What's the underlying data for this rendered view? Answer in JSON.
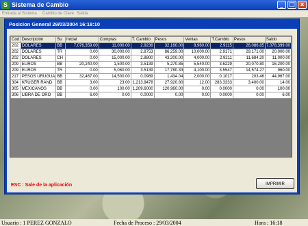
{
  "window": {
    "icon_letter": "S",
    "title": "Sistema de Cambio",
    "controls": {
      "minimize": "_",
      "maximize": "□",
      "close": "x"
    }
  },
  "menu": [
    "Entrada al Sistema",
    "Cambio de Clave",
    "Salida"
  ],
  "dialog": {
    "title": "Posicion General 29/03/2004 16:18:10",
    "table": {
      "headers": [
        "Cod",
        "Descripción",
        "Su",
        "Inicial",
        "Compras",
        "T. Cambio",
        "Pesos",
        "Ventas",
        "T.Cambio",
        "Pesos",
        "Saldo"
      ],
      "selected_row": 0,
      "rows": [
        [
          "202",
          "DOLARES",
          "BB",
          "7,076,359.00",
          "11,000.00",
          "2.9236",
          "32,160.00",
          "8,960.00",
          "2.9115",
          "26,086.85",
          "7,078,399.00"
        ],
        [
          "202",
          "DOLARES",
          "TR",
          "0.00",
          "30,000.00",
          "2.8753",
          "86,259.00",
          "10,000.00",
          "2.9171",
          "29,171.00",
          "20,000.00"
        ],
        [
          "202",
          "DOLARES",
          "CH",
          "0.00",
          "15,000.00",
          "2.8800",
          "43,200.00",
          "4,000.00",
          "2.9211",
          "11,684.20",
          "11,000.00"
        ],
        [
          "209",
          "EUROS",
          "BB",
          "20,240.00",
          "1,500.00",
          "3.5139",
          "5,270.85",
          "5,540.00",
          "3.6229",
          "20,070.80",
          "16,200.00"
        ],
        [
          "209",
          "EUROS",
          "TR",
          "0.00",
          "5,060.00",
          "3.5139",
          "17,780.33",
          "4,100.00",
          "3.5547",
          "14,574.27",
          "960.00"
        ],
        [
          "217",
          "PESOS URUGUA",
          "BB",
          "32,467.00",
          "14,500.00",
          "0.0989",
          "1,434.04",
          "2,000.00",
          "0.1017",
          "203.46",
          "44,967.00"
        ],
        [
          "304",
          "KRUGER RAND",
          "BB",
          "3.00",
          "23.00",
          "1,213.9478",
          "27,920.80",
          "12.00",
          "283.3333",
          "3,400.00",
          "14.00"
        ],
        [
          "305",
          "MEXICANOS",
          "BB",
          "0.00",
          "100.00",
          "1,209.6000",
          "120,960.00",
          "0.00",
          "0.0000",
          "0.00",
          "100.00"
        ],
        [
          "306",
          "LIBRA DE ORO",
          "BB",
          "6.00",
          "0.00",
          "0.0000",
          "0.00",
          "0.00",
          "0.0000",
          "0.00",
          "6.00"
        ]
      ]
    },
    "esc_message": "ESC : Sale de la aplicación",
    "print_button": "IMPRIMIR"
  },
  "statusbar": {
    "user": "Usuario : 1 PEREZ GONZALO",
    "fecha": "Fecha de Proceso : 29/03/2004",
    "hora": "Hora : 16:18"
  }
}
